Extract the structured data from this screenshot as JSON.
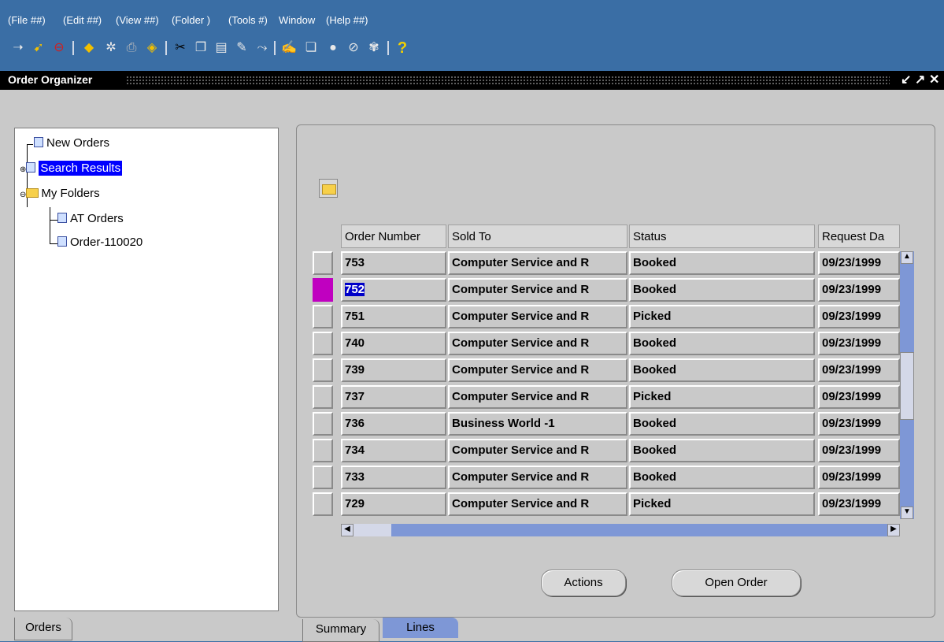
{
  "menu": [
    "(File ##)",
    "(Edit ##)",
    "(View ##)",
    "(Folder )",
    "(Tools #)",
    "Window",
    "(Help ##)"
  ],
  "toolbar_icons": [
    "new-icon",
    "flashlight-icon",
    "stop-icon",
    "save-icon",
    "navigator-icon",
    "print-icon",
    "close-form-icon",
    "cut-icon",
    "copy-icon",
    "paste-icon",
    "clear-icon",
    "delete-icon",
    "edit-field-icon",
    "zoom-icon",
    "translations-icon",
    "attachments-icon",
    "folder-tools-icon",
    "help-icon"
  ],
  "window": {
    "title": "Order Organizer",
    "controls": [
      "↙",
      "↗",
      "✕"
    ]
  },
  "tree": {
    "new_orders": "New Orders",
    "search_results": "Search Results",
    "my_folders": "My Folders",
    "at_orders": "AT Orders",
    "order_110020": "Order-110020"
  },
  "grid": {
    "headers": [
      "Order Number",
      "Sold To",
      "Status",
      "Request Da"
    ],
    "rows": [
      {
        "order": "753",
        "sold_to": "Computer Service and R",
        "status": "Booked",
        "date": "09/23/1999"
      },
      {
        "order": "752",
        "sold_to": "Computer Service and R",
        "status": "Booked",
        "date": "09/23/1999"
      },
      {
        "order": "751",
        "sold_to": "Computer Service and R",
        "status": "Picked",
        "date": "09/23/1999"
      },
      {
        "order": "740",
        "sold_to": "Computer Service and R",
        "status": "Booked",
        "date": "09/23/1999"
      },
      {
        "order": "739",
        "sold_to": "Computer Service and R",
        "status": "Booked",
        "date": "09/23/1999"
      },
      {
        "order": "737",
        "sold_to": "Computer Service and R",
        "status": "Picked",
        "date": "09/23/1999"
      },
      {
        "order": "736",
        "sold_to": "Business World -1",
        "status": "Booked",
        "date": "09/23/1999"
      },
      {
        "order": "734",
        "sold_to": "Computer Service and R",
        "status": "Booked",
        "date": "09/23/1999"
      },
      {
        "order": "733",
        "sold_to": "Computer Service and R",
        "status": "Booked",
        "date": "09/23/1999"
      },
      {
        "order": "729",
        "sold_to": "Computer Service and R",
        "status": "Picked",
        "date": "09/23/1999"
      }
    ]
  },
  "buttons": {
    "actions": "Actions",
    "open_order": "Open Order"
  },
  "tabs": {
    "orders": "Orders",
    "summary": "Summary",
    "lines": "Lines"
  },
  "colors": {
    "accent": "#3a6ea5",
    "selection": "#0000ff",
    "current_record": "#c000c0",
    "scrollbar": "#7e97d6"
  }
}
